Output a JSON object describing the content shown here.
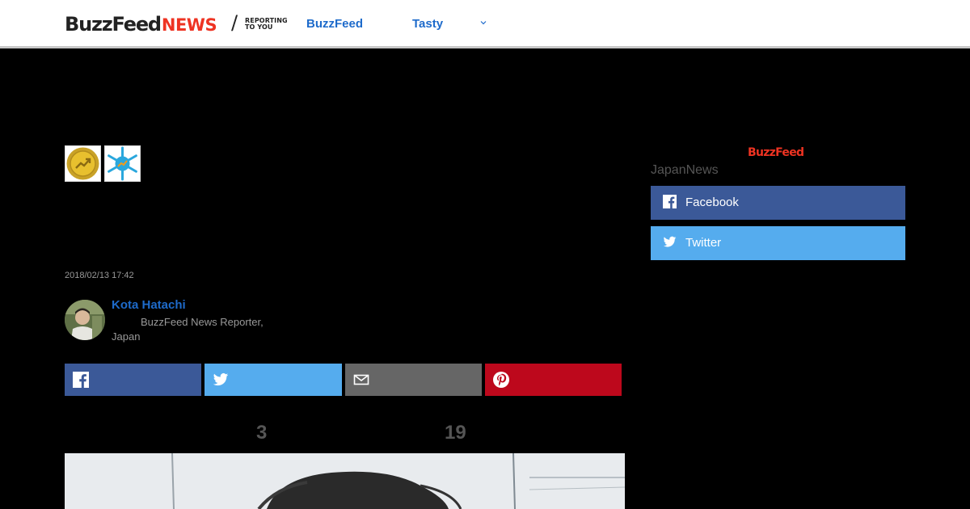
{
  "header": {
    "logo_buzz": "BuzzFeed",
    "logo_news": "NEWS",
    "slash": "/",
    "tagline_line1": "REPORTING",
    "tagline_line2": "TO YOU",
    "nav": [
      "BuzzFeed",
      "Tasty"
    ]
  },
  "article": {
    "timestamp": "2018/02/13 17:42",
    "author_name": "Kota Hatachi",
    "author_title": "BuzzFeed News Reporter, Japan"
  },
  "share_buttons": [
    {
      "icon": "facebook-icon",
      "color": "#3b5998"
    },
    {
      "icon": "twitter-icon",
      "color": "#55acee"
    },
    {
      "icon": "email-icon",
      "color": "#666666"
    },
    {
      "icon": "pinterest-icon",
      "color": "#bd081c"
    }
  ],
  "counts": {
    "first": "3",
    "second": "19"
  },
  "sidebar": {
    "logo": "BuzzFeed",
    "label": "JapanNews",
    "facebook_label": "Facebook",
    "twitter_label": "Twitter"
  },
  "colors": {
    "brand_red": "#ee3322",
    "link_blue": "#1e6bcb",
    "facebook": "#3b5998",
    "twitter": "#55acee"
  }
}
